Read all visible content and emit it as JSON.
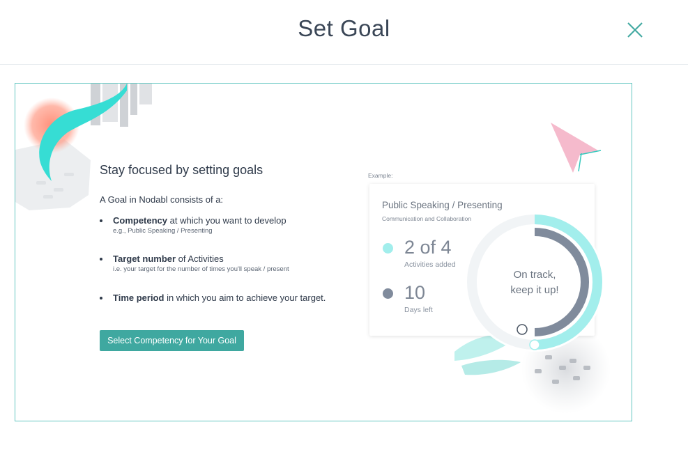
{
  "header": {
    "title": "Set Goal",
    "close_icon": "close-icon"
  },
  "colors": {
    "accent": "#3fa8a0",
    "border": "#64c6c1",
    "cyan": "#a2eeec",
    "slate": "#808b9c",
    "coral": "#ff8a73",
    "pink": "#f6b9cb"
  },
  "intro": {
    "heading": "Stay focused by setting goals",
    "lead": "A Goal in Nodabl consists of a:",
    "items": [
      {
        "bold": "Competency",
        "rest": " at which you want to develop",
        "hint": "e.g., Public Speaking / Presenting"
      },
      {
        "bold": "Target number",
        "rest": " of Activities",
        "hint": "i.e. your target for the number of times you'll speak / present"
      },
      {
        "bold": "Time period",
        "rest": " in which you aim to achieve your target.",
        "hint": ""
      }
    ],
    "cta_label": "Select Competency for Your Goal"
  },
  "example": {
    "label": "Example:",
    "title": "Public Speaking / Presenting",
    "subtitle": "Communication and Collaboration",
    "activities": {
      "value": "2 of 4",
      "label": "Activities added"
    },
    "days": {
      "value": "10",
      "label": "Days left"
    },
    "status_line1": "On track,",
    "status_line2": "keep it up!",
    "activities_progress": 0.5,
    "time_progress": 0.5
  }
}
